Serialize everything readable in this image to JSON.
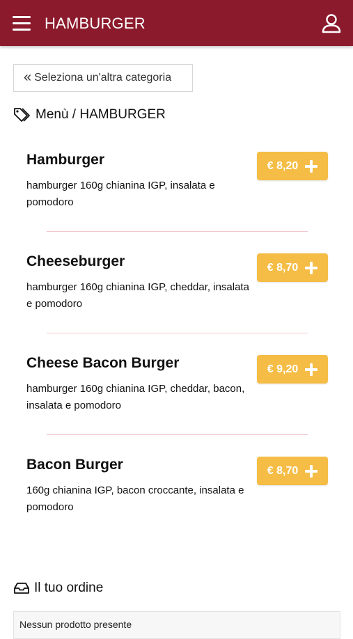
{
  "header": {
    "title": "HAMBURGER",
    "menu_icon": "hamburger-menu-icon",
    "user_icon": "user-icon",
    "color": "#8b1a2c"
  },
  "back_button": {
    "label": "Seleziona un'altra categoria",
    "icon": "double-chevron-left-icon"
  },
  "breadcrumb": {
    "icon": "tags-icon",
    "text": "Menù / HAMBURGER"
  },
  "products": [
    {
      "name": "Hamburger",
      "description": "hamburger 160g chianina IGP, insalata e pomodoro",
      "price": "€ 8,20"
    },
    {
      "name": "Cheeseburger",
      "description": "hamburger 160g chianina IGP, cheddar, insalata e pomodoro",
      "price": "€ 8,70"
    },
    {
      "name": "Cheese Bacon Burger",
      "description": "hamburger 160g chianina IGP, cheddar, bacon, insalata e pomodoro",
      "price": "€ 9,20"
    },
    {
      "name": "Bacon Burger",
      "description": "160g chianina IGP, bacon croccante, insalata e pomodoro",
      "price": "€ 8,70"
    }
  ],
  "price_button_color": "#f5bd45",
  "order": {
    "title": "Il tuo ordine",
    "icon": "inbox-tray-icon",
    "empty_text": "Nessun prodotto presente"
  }
}
